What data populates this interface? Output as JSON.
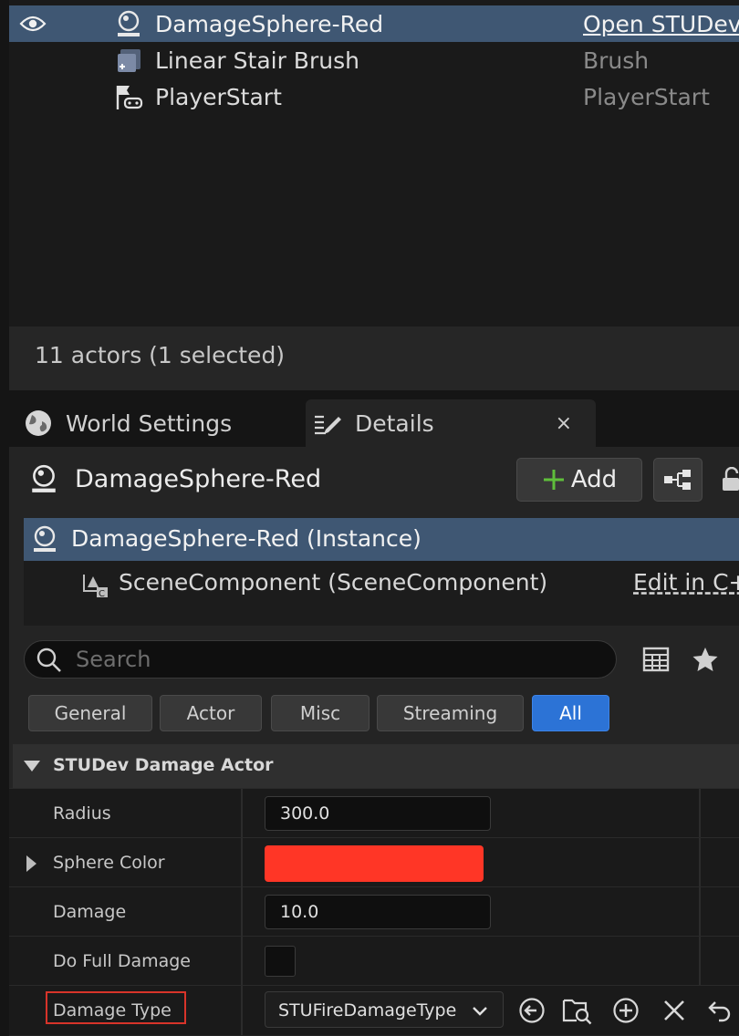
{
  "outliner": {
    "rows": [
      {
        "name": "DamageSphere-Red",
        "type": "Open STUDev",
        "icon": "sphere-actor-icon",
        "selected": true
      },
      {
        "name": "Linear Stair Brush",
        "type": "Brush",
        "icon": "brush-icon",
        "selected": false
      },
      {
        "name": "PlayerStart",
        "type": "PlayerStart",
        "icon": "player-start-icon",
        "selected": false
      }
    ],
    "status": "11 actors (1 selected)"
  },
  "tabs": {
    "world_settings": "World Settings",
    "details": "Details",
    "close": "×"
  },
  "details": {
    "actor_name": "DamageSphere-Red",
    "add_label": "Add",
    "components": {
      "root": "DamageSphere-Red (Instance)",
      "child": "SceneComponent (SceneComponent)",
      "edit_link": "Edit in C++"
    },
    "search_placeholder": "Search",
    "filters": [
      "General",
      "Actor",
      "Misc",
      "Streaming",
      "All"
    ],
    "active_filter": "All",
    "section_title": "STUDev Damage Actor",
    "properties": {
      "radius": {
        "label": "Radius",
        "value": "300.0"
      },
      "sphere_color": {
        "label": "Sphere Color",
        "color": "#ff3626"
      },
      "damage": {
        "label": "Damage",
        "value": "10.0"
      },
      "do_full_damage": {
        "label": "Do Full Damage",
        "checked": false
      },
      "damage_type": {
        "label": "Damage Type",
        "value": "STUFireDamageType"
      }
    }
  },
  "colors": {
    "selection": "#3f5773",
    "accent": "#2c73d6",
    "highlight_outline": "#d8342a"
  }
}
